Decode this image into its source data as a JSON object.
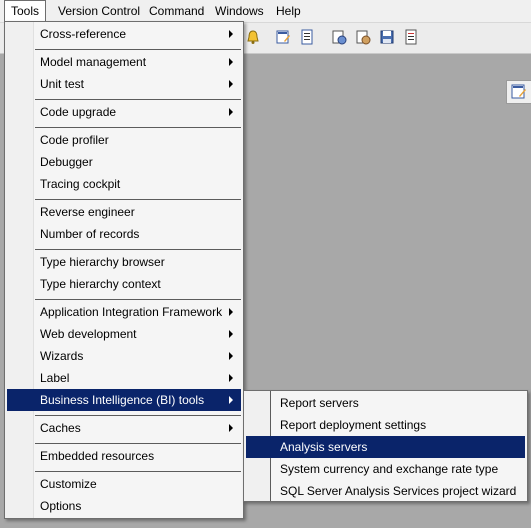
{
  "menubar": {
    "items": [
      {
        "label": "Tools",
        "active": true
      },
      {
        "label": "Version Control"
      },
      {
        "label": "Command"
      },
      {
        "label": "Windows"
      },
      {
        "label": "Help"
      }
    ]
  },
  "toolbar": {
    "icons": [
      "bell-icon",
      "edit-form-icon",
      "list-icon",
      "compile-icon",
      "compile-edit-icon",
      "save-icon",
      "properties-icon"
    ]
  },
  "tools_menu": {
    "items": [
      {
        "label": "Cross-reference",
        "submenu": true
      },
      {
        "label": "Model management",
        "submenu": true
      },
      {
        "label": "Unit test",
        "submenu": true
      },
      {
        "label": "Code upgrade",
        "submenu": true
      },
      {
        "label": "Code profiler"
      },
      {
        "label": "Debugger"
      },
      {
        "label": "Tracing cockpit"
      },
      {
        "label": "Reverse engineer"
      },
      {
        "label": "Number of records"
      },
      {
        "label": "Type hierarchy browser"
      },
      {
        "label": "Type hierarchy context"
      },
      {
        "label": "Application Integration Framework",
        "submenu": true
      },
      {
        "label": "Web development",
        "submenu": true
      },
      {
        "label": "Wizards",
        "submenu": true
      },
      {
        "label": "Label",
        "submenu": true
      },
      {
        "label": "Business Intelligence (BI) tools",
        "submenu": true,
        "highlighted": true
      },
      {
        "label": "Caches",
        "submenu": true
      },
      {
        "label": "Embedded resources"
      },
      {
        "label": "Customize"
      },
      {
        "label": "Options"
      }
    ]
  },
  "bi_submenu": {
    "items": [
      {
        "label": "Report servers"
      },
      {
        "label": "Report deployment settings"
      },
      {
        "label": "Analysis servers",
        "highlighted": true
      },
      {
        "label": "System currency and exchange rate type"
      },
      {
        "label": "SQL Server Analysis Services project wizard"
      }
    ]
  },
  "colors": {
    "highlight": "#0a246a",
    "background": "#a8a8a8"
  }
}
